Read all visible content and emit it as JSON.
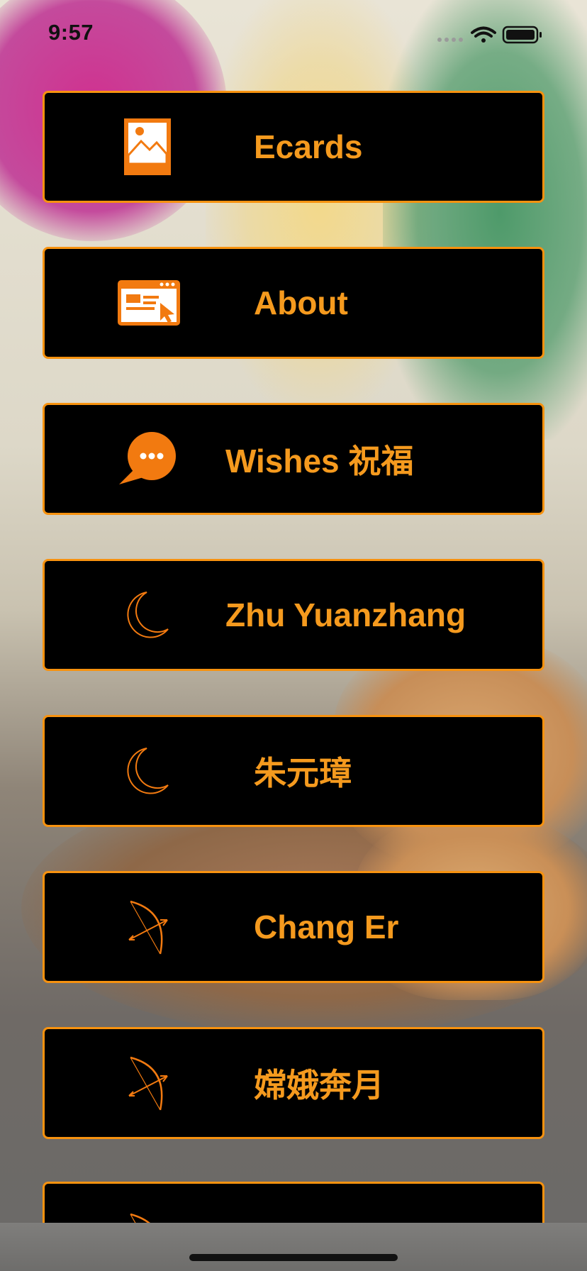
{
  "status_bar": {
    "time": "9:57",
    "signal_icon": "signal-dots-icon",
    "wifi_icon": "wifi-icon",
    "battery_icon": "battery-icon"
  },
  "menu": {
    "accent_color": "#f59a1e",
    "items": [
      {
        "label": "Ecards",
        "icon": "picture-icon"
      },
      {
        "label": "About",
        "icon": "browser-window-icon"
      },
      {
        "label": "Wishes 祝福",
        "icon": "speech-bubble-icon"
      },
      {
        "label": "Zhu Yuanzhang",
        "icon": "crescent-moon-icon"
      },
      {
        "label": "朱元璋",
        "icon": "crescent-moon-icon"
      },
      {
        "label": "Chang Er",
        "icon": "bow-arrow-icon"
      },
      {
        "label": "嫦娥奔月",
        "icon": "bow-arrow-icon"
      },
      {
        "label": "",
        "icon": "bow-arrow-icon"
      }
    ]
  }
}
